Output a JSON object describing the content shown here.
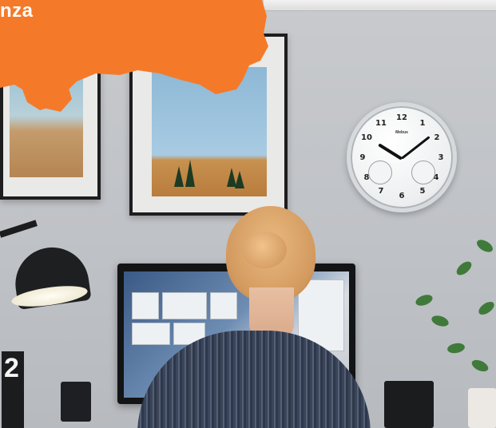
{
  "banner": {
    "text": "nza",
    "color": "#f47a2a"
  },
  "clock": {
    "brand": "Mebus",
    "numbers": [
      "12",
      "1",
      "2",
      "3",
      "4",
      "5",
      "6",
      "7",
      "8",
      "9",
      "10",
      "11"
    ]
  },
  "desk_cube": {
    "digit": "2"
  }
}
